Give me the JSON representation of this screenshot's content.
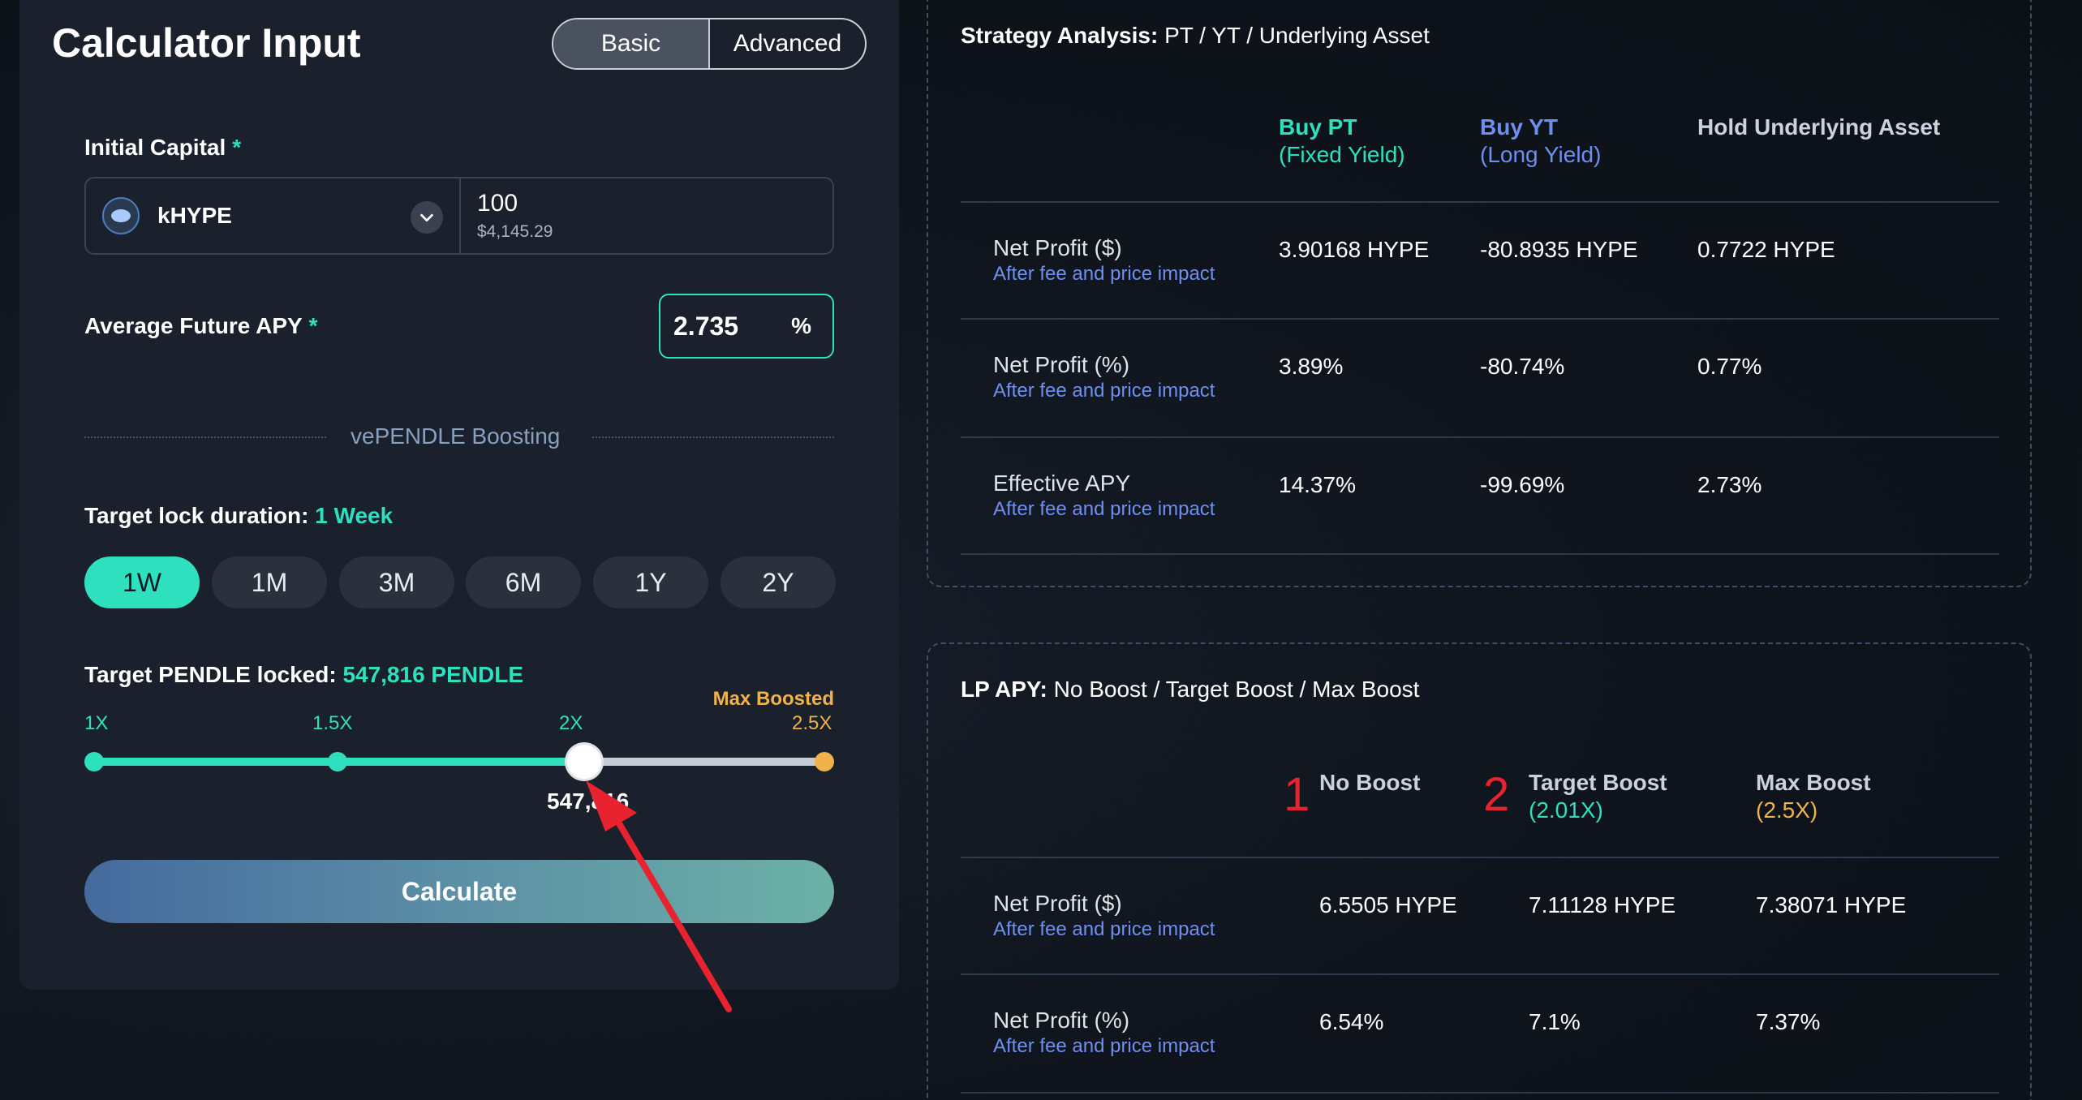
{
  "calculator": {
    "title": "Calculator Input",
    "modes": [
      "Basic",
      "Advanced"
    ],
    "active_mode": "Basic",
    "initial_capital_label": "Initial Capital",
    "required_mark": "*",
    "token": "kHYPE",
    "amount": "100",
    "amount_usd": "$4,145.29",
    "apy_label": "Average Future APY",
    "apy_value": "2.735",
    "apy_unit": "%",
    "boost_heading": "vePENDLE Boosting",
    "lock_label": "Target lock duration:",
    "lock_value": "1 Week",
    "durations": [
      "1W",
      "1M",
      "3M",
      "6M",
      "1Y",
      "2Y"
    ],
    "active_duration": "1W",
    "pendle_label": "Target PENDLE locked:",
    "pendle_value": "547,816 PENDLE",
    "max_boosted_label": "Max Boosted",
    "slider_ticks": [
      "1X",
      "1.5X",
      "2X",
      "2.5X"
    ],
    "slider_value_label": "547,816",
    "slider_level_boost": 2.01,
    "calculate_label": "Calculate"
  },
  "strategy": {
    "title_bold": "Strategy Analysis:",
    "title_rest": "PT / YT / Underlying Asset",
    "columns": [
      {
        "label": "Buy PT",
        "sub": "(Fixed Yield)",
        "color": "#2fe0bf"
      },
      {
        "label": "Buy YT",
        "sub": "(Long Yield)",
        "color": "#6f8ff0"
      },
      {
        "label": "Hold Underlying Asset",
        "sub": "",
        "color": "#c9d2de"
      }
    ],
    "rows": [
      {
        "label": "Net Profit ($)",
        "note": "After fee and price impact",
        "values": [
          "3.90168 HYPE",
          "-80.8935 HYPE",
          "0.7722 HYPE"
        ]
      },
      {
        "label": "Net Profit (%)",
        "note": "After fee and price impact",
        "values": [
          "3.89%",
          "-80.74%",
          "0.77%"
        ]
      },
      {
        "label": "Effective APY",
        "note": "After fee and price impact",
        "values": [
          "14.37%",
          "-99.69%",
          "2.73%"
        ]
      }
    ]
  },
  "lp": {
    "title_bold": "LP APY:",
    "title_rest": "No Boost / Target Boost / Max Boost",
    "markers": [
      "1",
      "2"
    ],
    "columns": [
      {
        "label": "No Boost",
        "sub": "",
        "sub_color": "#2fe0bf"
      },
      {
        "label": "Target Boost",
        "sub": "(2.01X)",
        "sub_color": "#2fe0bf"
      },
      {
        "label": "Max Boost",
        "sub": "(2.5X)",
        "sub_color": "#f0b24a"
      }
    ],
    "rows": [
      {
        "label": "Net Profit ($)",
        "note": "After fee and price impact",
        "values": [
          "6.5505 HYPE",
          "7.11128 HYPE",
          "7.38071 HYPE"
        ]
      },
      {
        "label": "Net Profit (%)",
        "note": "After fee and price impact",
        "values": [
          "6.54%",
          "7.1%",
          "7.37%"
        ]
      }
    ]
  },
  "colors": {
    "accent": "#2fe0bf",
    "max": "#f0b24a",
    "note": "#6f8ff0",
    "annotation": "#e8222e"
  }
}
